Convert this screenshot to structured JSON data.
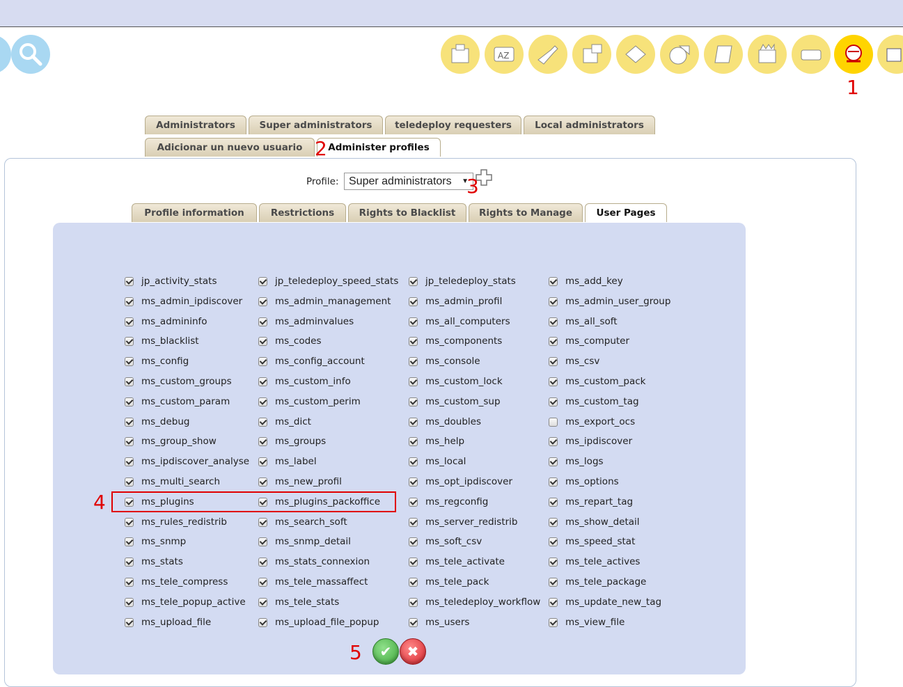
{
  "toolbar": {
    "icons": [
      "search-icon",
      "packages-icon",
      "dictionary-icon",
      "tools-icon",
      "network-icon",
      "documents-icon",
      "statistics-icon",
      "scroll-icon",
      "firewall-icon",
      "tag-icon",
      "user-admin-icon",
      "help-icon"
    ]
  },
  "annotations": {
    "a1": "1",
    "a2": "2",
    "a3": "3",
    "a4": "4",
    "a5": "5"
  },
  "tabs_top": {
    "row1": [
      "Administrators",
      "Super administrators",
      "teledeploy requesters",
      "Local administrators"
    ],
    "row2": [
      "Adicionar un nuevo usuario",
      "Administer profiles"
    ],
    "active": "Administer profiles"
  },
  "profile": {
    "label": "Profile:",
    "selected": "Super administrators"
  },
  "tabs_inner": {
    "items": [
      "Profile information",
      "Restrictions",
      "Rights to Blacklist",
      "Rights to Manage",
      "User Pages"
    ],
    "active": "User Pages"
  },
  "pages": {
    "col1": [
      {
        "name": "jp_activity_stats",
        "checked": true
      },
      {
        "name": "ms_admin_ipdiscover",
        "checked": true
      },
      {
        "name": "ms_admininfo",
        "checked": true
      },
      {
        "name": "ms_blacklist",
        "checked": true
      },
      {
        "name": "ms_config",
        "checked": true
      },
      {
        "name": "ms_custom_groups",
        "checked": true
      },
      {
        "name": "ms_custom_param",
        "checked": true
      },
      {
        "name": "ms_debug",
        "checked": true
      },
      {
        "name": "ms_group_show",
        "checked": true
      },
      {
        "name": "ms_ipdiscover_analyse",
        "checked": true
      },
      {
        "name": "ms_multi_search",
        "checked": true
      },
      {
        "name": "ms_plugins",
        "checked": true
      },
      {
        "name": "ms_rules_redistrib",
        "checked": true
      },
      {
        "name": "ms_snmp",
        "checked": true
      },
      {
        "name": "ms_stats",
        "checked": true
      },
      {
        "name": "ms_tele_compress",
        "checked": true
      },
      {
        "name": "ms_tele_popup_active",
        "checked": true
      },
      {
        "name": "ms_upload_file",
        "checked": true
      }
    ],
    "col2": [
      {
        "name": "jp_teledeploy_speed_stats",
        "checked": true
      },
      {
        "name": "ms_admin_management",
        "checked": true
      },
      {
        "name": "ms_adminvalues",
        "checked": true
      },
      {
        "name": "ms_codes",
        "checked": true
      },
      {
        "name": "ms_config_account",
        "checked": true
      },
      {
        "name": "ms_custom_info",
        "checked": true
      },
      {
        "name": "ms_custom_perim",
        "checked": true
      },
      {
        "name": "ms_dict",
        "checked": true
      },
      {
        "name": "ms_groups",
        "checked": true
      },
      {
        "name": "ms_label",
        "checked": true
      },
      {
        "name": "ms_new_profil",
        "checked": true
      },
      {
        "name": "ms_plugins_packoffice",
        "checked": true
      },
      {
        "name": "ms_search_soft",
        "checked": true
      },
      {
        "name": "ms_snmp_detail",
        "checked": true
      },
      {
        "name": "ms_stats_connexion",
        "checked": true
      },
      {
        "name": "ms_tele_massaffect",
        "checked": true
      },
      {
        "name": "ms_tele_stats",
        "checked": true
      },
      {
        "name": "ms_upload_file_popup",
        "checked": true
      }
    ],
    "col3": [
      {
        "name": "jp_teledeploy_stats",
        "checked": true
      },
      {
        "name": "ms_admin_profil",
        "checked": true
      },
      {
        "name": "ms_all_computers",
        "checked": true
      },
      {
        "name": "ms_components",
        "checked": true
      },
      {
        "name": "ms_console",
        "checked": true
      },
      {
        "name": "ms_custom_lock",
        "checked": true
      },
      {
        "name": "ms_custom_sup",
        "checked": true
      },
      {
        "name": "ms_doubles",
        "checked": true
      },
      {
        "name": "ms_help",
        "checked": true
      },
      {
        "name": "ms_local",
        "checked": true
      },
      {
        "name": "ms_opt_ipdiscover",
        "checked": true
      },
      {
        "name": "ms_regconfig",
        "checked": true
      },
      {
        "name": "ms_server_redistrib",
        "checked": true
      },
      {
        "name": "ms_soft_csv",
        "checked": true
      },
      {
        "name": "ms_tele_activate",
        "checked": true
      },
      {
        "name": "ms_tele_pack",
        "checked": true
      },
      {
        "name": "ms_teledeploy_workflow",
        "checked": true
      },
      {
        "name": "ms_users",
        "checked": true
      }
    ],
    "col4": [
      {
        "name": "ms_add_key",
        "checked": true
      },
      {
        "name": "ms_admin_user_group",
        "checked": true
      },
      {
        "name": "ms_all_soft",
        "checked": true
      },
      {
        "name": "ms_computer",
        "checked": true
      },
      {
        "name": "ms_csv",
        "checked": true
      },
      {
        "name": "ms_custom_pack",
        "checked": true
      },
      {
        "name": "ms_custom_tag",
        "checked": true
      },
      {
        "name": "ms_export_ocs",
        "checked": false
      },
      {
        "name": "ms_ipdiscover",
        "checked": true
      },
      {
        "name": "ms_logs",
        "checked": true
      },
      {
        "name": "ms_options",
        "checked": true
      },
      {
        "name": "ms_repart_tag",
        "checked": true
      },
      {
        "name": "ms_show_detail",
        "checked": true
      },
      {
        "name": "ms_speed_stat",
        "checked": true
      },
      {
        "name": "ms_tele_actives",
        "checked": true
      },
      {
        "name": "ms_tele_package",
        "checked": true
      },
      {
        "name": "ms_update_new_tag",
        "checked": true
      },
      {
        "name": "ms_view_file",
        "checked": true
      }
    ]
  },
  "colors": {
    "accent_annotation": "#e00000",
    "panel_bg": "#d3dbf2",
    "topbar_bg": "#d7dcf1"
  }
}
